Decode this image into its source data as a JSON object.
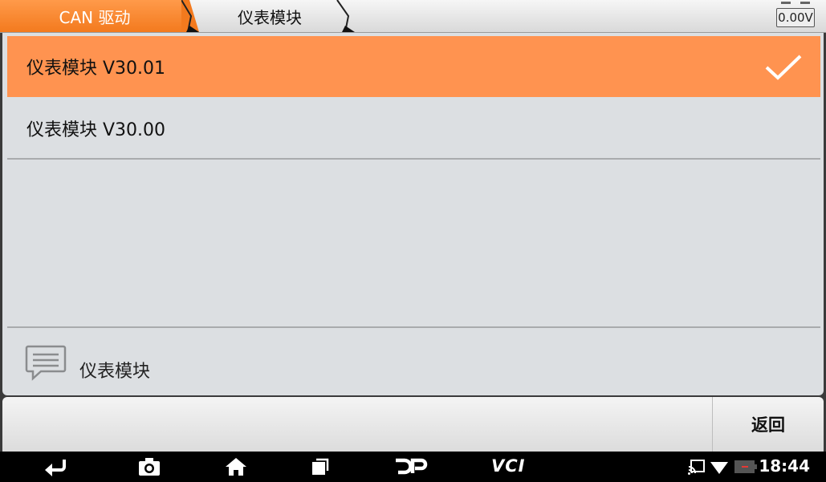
{
  "breadcrumb": {
    "items": [
      {
        "label": "CAN 驱动"
      },
      {
        "label": "仪表模块"
      }
    ]
  },
  "battery_voltage": "0.00V",
  "list": {
    "items": [
      {
        "label": "仪表模块  V30.01",
        "selected": true
      },
      {
        "label": "仪表模块  V30.00",
        "selected": false
      }
    ]
  },
  "description": {
    "icon": "message-icon",
    "text": "仪表模块"
  },
  "buttons": {
    "back": "返回"
  },
  "navbar": {
    "vci_label": "VCI",
    "time": "18:44"
  },
  "colors": {
    "accent": "#ff9350",
    "breadcrumb_active": "#f37a1e",
    "panel": "#dcdfe2"
  }
}
